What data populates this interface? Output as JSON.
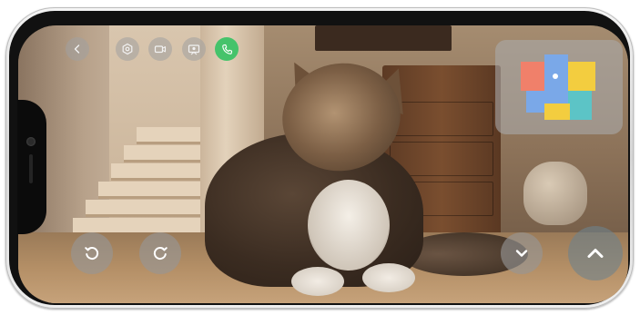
{
  "app": {
    "screen": "robot-camera-view"
  },
  "toolbar": {
    "buttons": [
      {
        "id": "back",
        "icon": "chevron-left-icon"
      },
      {
        "id": "settings",
        "icon": "hexagon-settings-icon"
      },
      {
        "id": "record",
        "icon": "video-camera-icon"
      },
      {
        "id": "capture",
        "icon": "photo-capture-icon"
      },
      {
        "id": "call",
        "icon": "phone-icon"
      }
    ]
  },
  "controls": {
    "rotate_left": {
      "icon": "rotate-left-icon"
    },
    "rotate_right": {
      "icon": "rotate-right-icon"
    },
    "move_down": {
      "icon": "chevron-down-icon"
    },
    "move_up": {
      "icon": "chevron-up-icon"
    }
  },
  "minimap": {
    "rooms": [
      {
        "name": "room-1",
        "color": "#f0806a"
      },
      {
        "name": "room-2",
        "color": "#7aa8e8"
      },
      {
        "name": "room-3",
        "color": "#f3cd3f"
      },
      {
        "name": "room-4",
        "color": "#5cc4c6"
      },
      {
        "name": "room-5",
        "color": "#f3cd3f"
      }
    ],
    "robot_marker_color": "#ffffff"
  },
  "colors": {
    "call_green": "#45c36b",
    "button_gray": "#9a9a9a"
  }
}
